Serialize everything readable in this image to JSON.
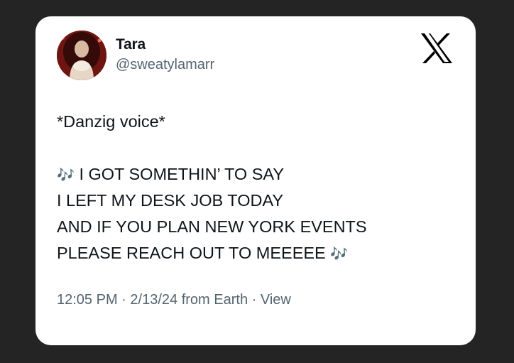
{
  "tweet": {
    "author_name": "Tara",
    "author_handle": "@sweatylamarr",
    "text_lines": [
      "*Danzig voice*",
      "",
      "I GOT SOMETHIN’ TO SAY",
      "I LEFT MY DESK JOB TODAY",
      "AND IF YOU PLAN NEW YORK EVENTS",
      "PLEASE REACH OUT TO MEEEEE"
    ],
    "music_emoji": "🎶",
    "time": "12:05 PM",
    "date": "2/13/24",
    "source": "from Earth",
    "separator": "·",
    "view_label": "View"
  },
  "icons": {
    "logo": "x-logo-icon",
    "avatar": "profile-photo"
  },
  "colors": {
    "background": "#242424",
    "card": "#ffffff",
    "text_primary": "#0f1419",
    "text_secondary": "#536471"
  }
}
